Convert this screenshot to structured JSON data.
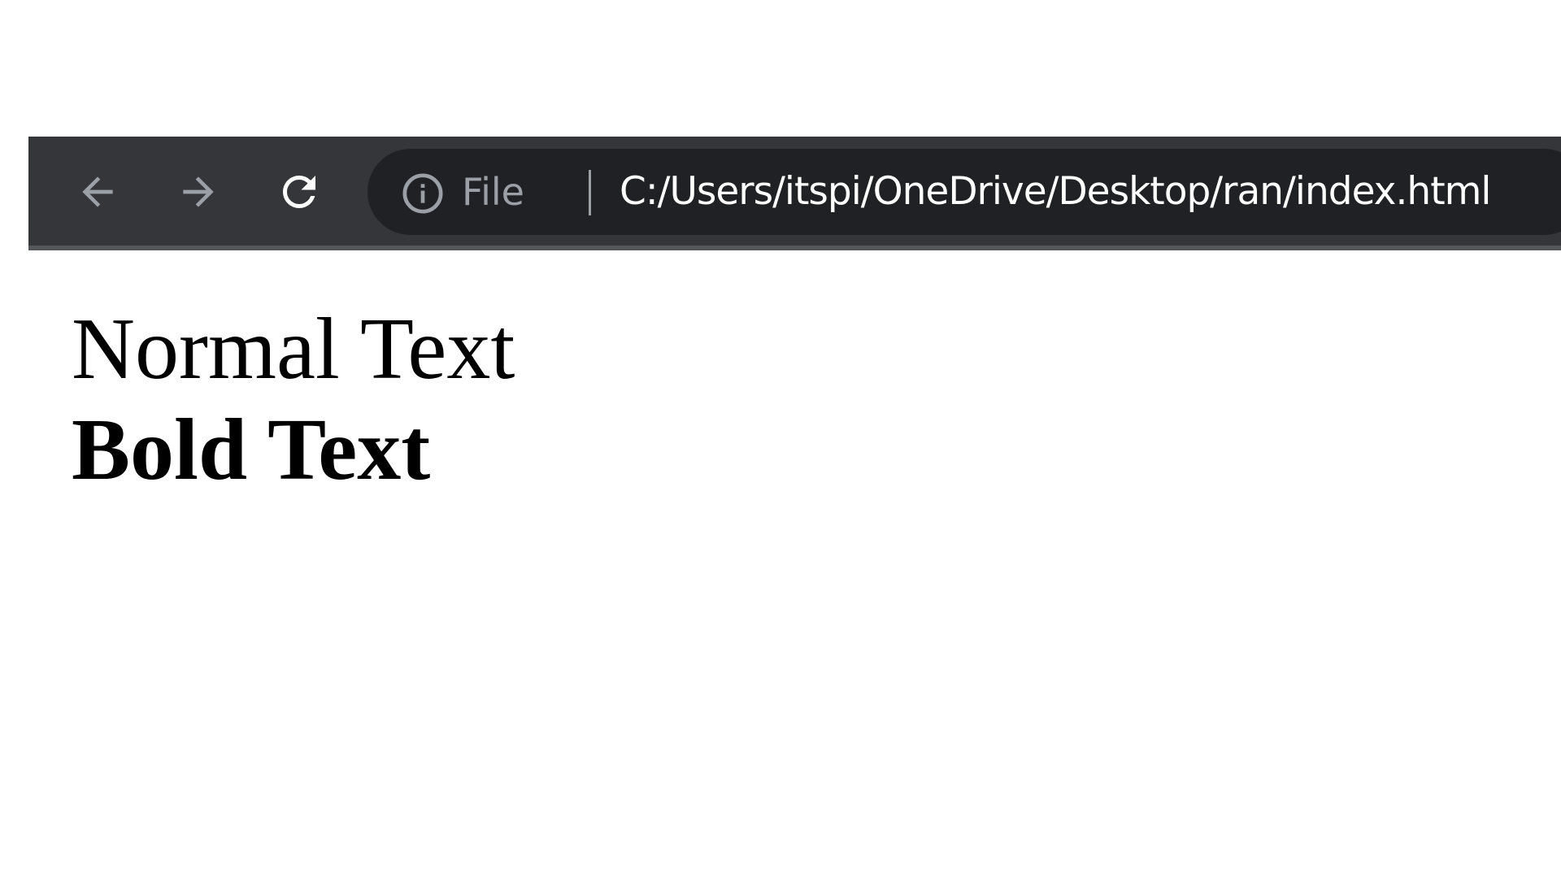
{
  "browser": {
    "nav_icons": [
      "arrow-left-icon",
      "arrow-right-icon",
      "reload-icon"
    ],
    "address_bar": {
      "security_icon": "info-icon",
      "scheme_label": "File",
      "url": "C:/Users/itspi/OneDrive/Desktop/ran/index.html"
    },
    "colors": {
      "toolbar": "#35363a",
      "omnibox": "#202124",
      "icon_disabled": "#9aa0a6",
      "icon_enabled": "#ffffff"
    }
  },
  "page": {
    "normal_text": "Normal Text",
    "bold_text": "Bold Text"
  }
}
